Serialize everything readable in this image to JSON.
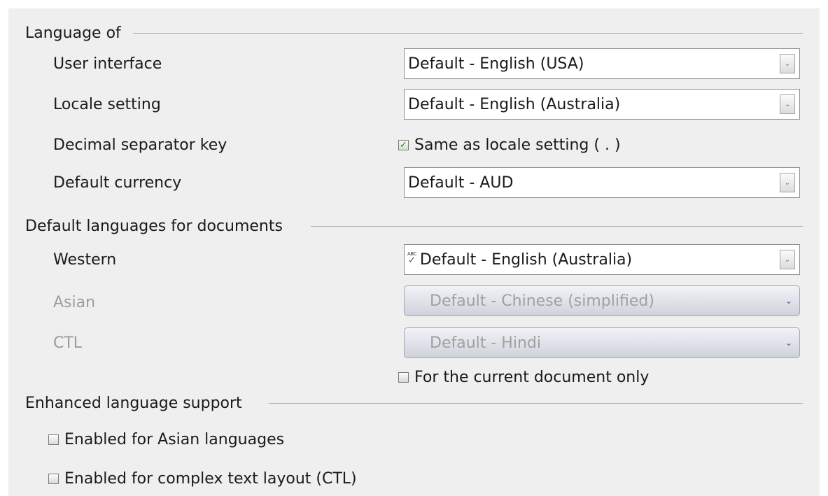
{
  "sections": {
    "language_of": "Language of",
    "default_languages": "Default languages for documents",
    "enhanced": "Enhanced language support"
  },
  "rows": {
    "user_interface": {
      "label": "User interface",
      "value": "Default - English (USA)"
    },
    "locale_setting": {
      "label": "Locale setting",
      "value": "Default - English (Australia)"
    },
    "decimal_separator": {
      "label": "Decimal separator key",
      "checkbox_label": "Same as locale setting ( . )",
      "checked": true
    },
    "default_currency": {
      "label": "Default currency",
      "value": "Default - AUD"
    },
    "western": {
      "label": "Western",
      "value": "Default - English (Australia)",
      "spell_icon": "spell-check-icon"
    },
    "asian": {
      "label": "Asian",
      "value": "Default - Chinese (simplified)",
      "enabled": false
    },
    "ctl": {
      "label": "CTL",
      "value": "Default - Hindi",
      "enabled": false
    },
    "current_doc_only": {
      "label": "For the current document only",
      "checked": false
    }
  },
  "enhanced_options": {
    "asian": {
      "label": "Enabled for Asian languages",
      "checked": false
    },
    "ctl": {
      "label": "Enabled for complex text layout (CTL)",
      "checked": false
    }
  },
  "icons": {
    "dropdown": "chevron-down-icon",
    "check": "checkmark-icon",
    "spell": "spell-check-icon"
  },
  "colors": {
    "background": "#efefef",
    "disabled_text": "#9c9c9c",
    "check_green": "#3a7a2a"
  },
  "glyphs": {
    "chevron": "⌄",
    "check": "✓",
    "spell_abc": "ABC",
    "spell_mark": "✓"
  }
}
